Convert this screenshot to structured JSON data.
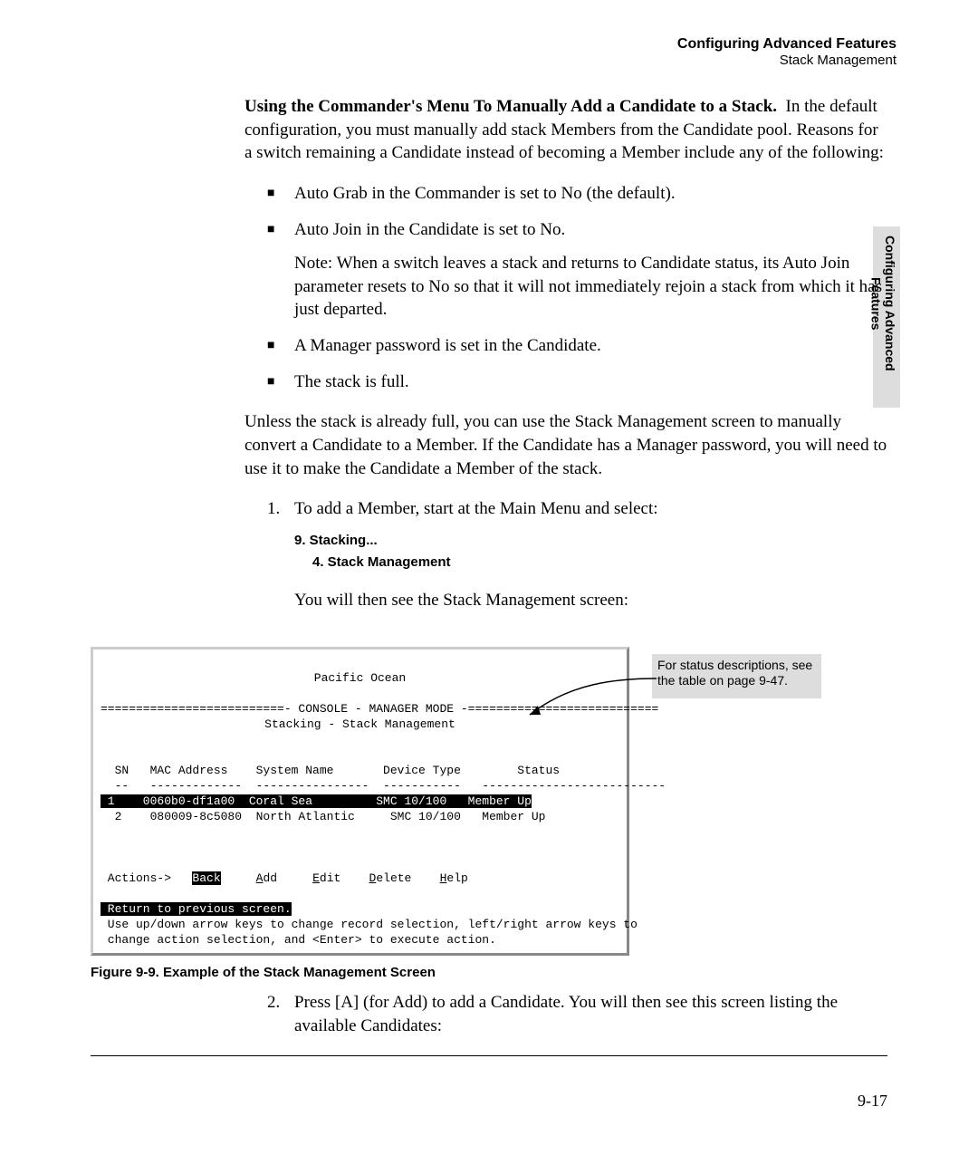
{
  "header": {
    "title": "Configuring Advanced Features",
    "subtitle": "Stack Management"
  },
  "sideTab": {
    "line1": "Configuring Advanced",
    "line2": "Features"
  },
  "intro": {
    "leadBold": "Using the Commander's Menu To Manually Add a Candidate to a Stack.",
    "text": "In the default configuration, you must manually add stack Members from the Candidate pool. Reasons for a switch remaining a Candidate instead of becoming a Member include any of the following:"
  },
  "bullets": {
    "b1": {
      "term1": "Auto Grab",
      "mid": " in the Commander is set to ",
      "term2": "No",
      "tail": " (the default)."
    },
    "b2": {
      "term1": "Auto Join",
      "mid": " in the Candidate is set to ",
      "term2": "No",
      "tail": "."
    },
    "note": {
      "lead": "Note:",
      "text1": " When a switch leaves a stack and returns to Candidate status, its ",
      "term1": "Auto Join",
      "text2": " parameter resets to ",
      "term2": "No",
      "text3": " so that it will not immediately rejoin a stack from which it has just departed."
    },
    "b3": "A Manager password is set in the Candidate.",
    "b4": "The stack is full."
  },
  "para2": "Unless the stack is already full, you can use the Stack Management screen to manually convert a Candidate to a Member. If the Candidate has a Manager password, you will need to use it to make the Candidate a Member of the stack.",
  "step1": {
    "num": "1.",
    "text": "To add a Member, start at the Main Menu and select:"
  },
  "menu": {
    "l1": "9. Stacking...",
    "l2": "4. Stack Management"
  },
  "afterMenu": "You will then see the Stack Management screen:",
  "terminal": {
    "title": "Pacific Ocean",
    "separator": "==========================- CONSOLE - MANAGER MODE -===========================",
    "subtitle": "Stacking - Stack Management",
    "header": "  SN   MAC Address    System Name       Device Type        Status",
    "headerSep": "  --   -------------  ----------------  -----------   --------------------------",
    "row1_a": " 1    0060b0-df1a00  Coral Sea        ",
    "row1_b": " SMC 10/100 ",
    "row1_c": "  Member Up",
    "row2": "  2    080009-8c5080  North Atlantic     SMC 10/100   Member Up",
    "actions_pre": " Actions->   ",
    "actions_back": "Back",
    "actions_add": "dd",
    "actions_edit": "dit",
    "actions_delete": "elete",
    "actions_help": "elp",
    "return": " Return to previous screen.",
    "help1": " Use up/down arrow keys to change record selection, left/right arrow keys to",
    "help2": " change action selection, and <Enter> to execute action."
  },
  "callout": "For status descriptions, see the table on page 9-47.",
  "figcap": "Figure 9-9.  Example of the Stack Management Screen",
  "step2": {
    "num": "2.",
    "pre": "Press [A] (for ",
    "add": "Add",
    "post": ") to add a Candidate. You will then see this screen listing the available Candidates:"
  },
  "pageNum": "9-17"
}
